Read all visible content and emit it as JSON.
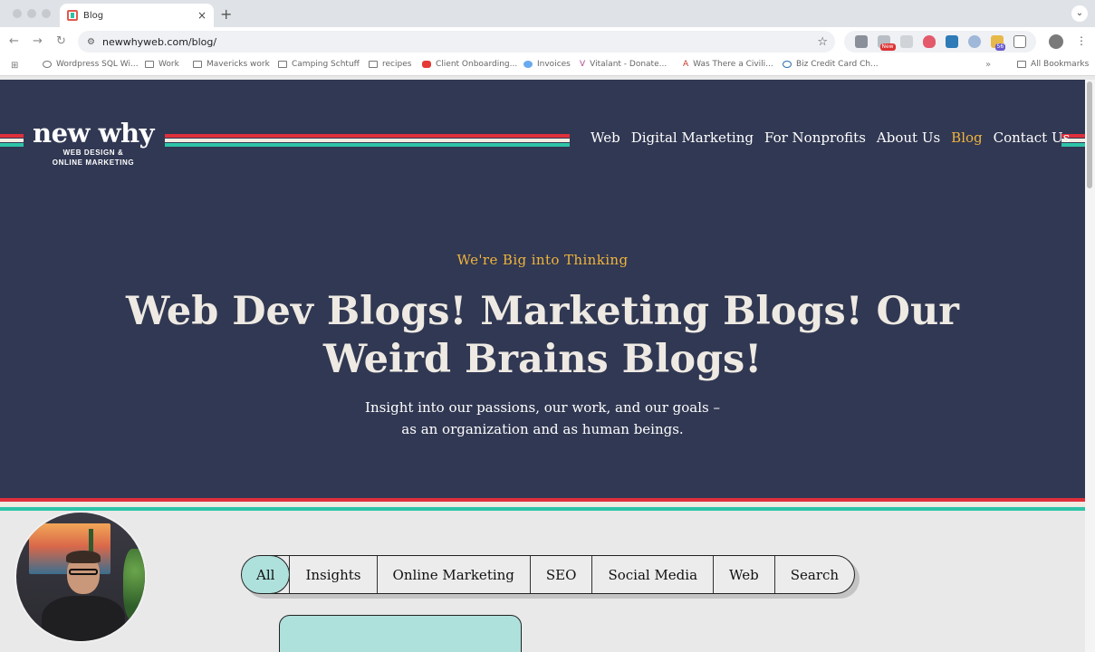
{
  "browser": {
    "tab_title": "Blog",
    "tab_close": "×",
    "new_tab": "+",
    "tab_menu": "⌄",
    "url": "newwhyweb.com/blog/",
    "back": "←",
    "forward": "→",
    "reload": "↻",
    "star": "☆",
    "ext_badge_new": "New",
    "ext_badge_count": "56",
    "kebab": "⋮",
    "apps": "⊞",
    "bookmarks": [
      {
        "label": "Wordpress SQL Wi...",
        "icon": "globe-icon"
      },
      {
        "label": "Work",
        "icon": "folder-icon"
      },
      {
        "label": "Mavericks work",
        "icon": "folder-icon"
      },
      {
        "label": "Camping Schtuff",
        "icon": "folder-icon"
      },
      {
        "label": "recipes",
        "icon": "folder-icon"
      },
      {
        "label": "Client Onboarding...",
        "icon": "youtube-icon"
      },
      {
        "label": "Invoices",
        "icon": "circle-icon"
      },
      {
        "label": "Vitalant - Donate...",
        "icon": "vitalant-icon"
      },
      {
        "label": "Was There a Civili...",
        "icon": "a-icon"
      },
      {
        "label": "Biz Credit Card Ch...",
        "icon": "chase-icon"
      }
    ],
    "bookmarks_overflow": "»",
    "all_bookmarks": "All Bookmarks"
  },
  "site": {
    "logo_main": "new why",
    "logo_sub_1": "WEB DESIGN &",
    "logo_sub_2": "ONLINE MARKETING",
    "nav": [
      {
        "label": "Web",
        "active": false
      },
      {
        "label": "Digital Marketing",
        "active": false
      },
      {
        "label": "For Nonprofits",
        "active": false
      },
      {
        "label": "About Us",
        "active": false
      },
      {
        "label": "Blog",
        "active": true
      },
      {
        "label": "Contact Us",
        "active": false
      }
    ],
    "colors": {
      "hero_bg": "#313853",
      "accent_gold": "#f0b43c",
      "stripe_red": "#e0303c",
      "stripe_teal": "#2ec4a8",
      "filter_active": "#aee0dc"
    }
  },
  "hero": {
    "eyebrow": "We're Big into Thinking",
    "headline": "Web Dev Blogs! Marketing Blogs! Our Weird Brains Blogs!",
    "lede": "Insight into our passions, our work, and our goals – as an organization and as human beings."
  },
  "filters": [
    {
      "label": "All",
      "active": true
    },
    {
      "label": "Insights",
      "active": false
    },
    {
      "label": "Online Marketing",
      "active": false
    },
    {
      "label": "SEO",
      "active": false
    },
    {
      "label": "Social Media",
      "active": false
    },
    {
      "label": "Web",
      "active": false
    },
    {
      "label": "Search",
      "active": false
    }
  ]
}
